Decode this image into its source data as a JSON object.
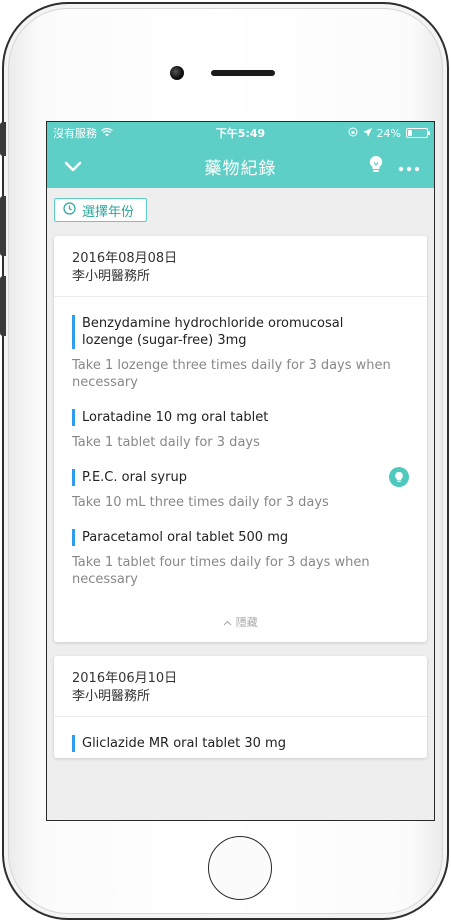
{
  "status_bar": {
    "carrier": "沒有服務",
    "time": "下午5:49",
    "battery": "24%",
    "battery_level": 0.24
  },
  "nav": {
    "title": "藥物紀錄",
    "back_icon": "chevron-down-icon",
    "tip_icon": "lightbulb-icon",
    "more_icon": "more-icon"
  },
  "filter": {
    "year_button_label": "選擇年份",
    "icon": "clock-icon"
  },
  "records": [
    {
      "date": "2016年08月08日",
      "clinic": "李小明醫務所",
      "medications": [
        {
          "name": "Benzydamine hydrochloride oromucosal lozenge (sugar-free) 3mg",
          "instruction": "Take 1 lozenge three times daily for 3 days when necessary",
          "has_tip": false
        },
        {
          "name": "Loratadine 10 mg oral tablet",
          "instruction": "Take 1 tablet daily for 3 days",
          "has_tip": false
        },
        {
          "name": "P.E.C. oral syrup",
          "instruction": "Take 10 mL three times daily for 3 days",
          "has_tip": true
        },
        {
          "name": "Paracetamol oral tablet 500 mg",
          "instruction": "Take 1 tablet four times daily for 3 days when necessary",
          "has_tip": false
        }
      ],
      "toggle_label": "隱藏"
    },
    {
      "date": "2016年06月10日",
      "clinic": "李小明醫務所",
      "medications": [
        {
          "name": "Gliclazide MR oral tablet 30 mg"
        }
      ]
    }
  ],
  "colors": {
    "accent": "#5dcfc6",
    "marker": "#2e9df0",
    "muted_text": "#888888"
  }
}
